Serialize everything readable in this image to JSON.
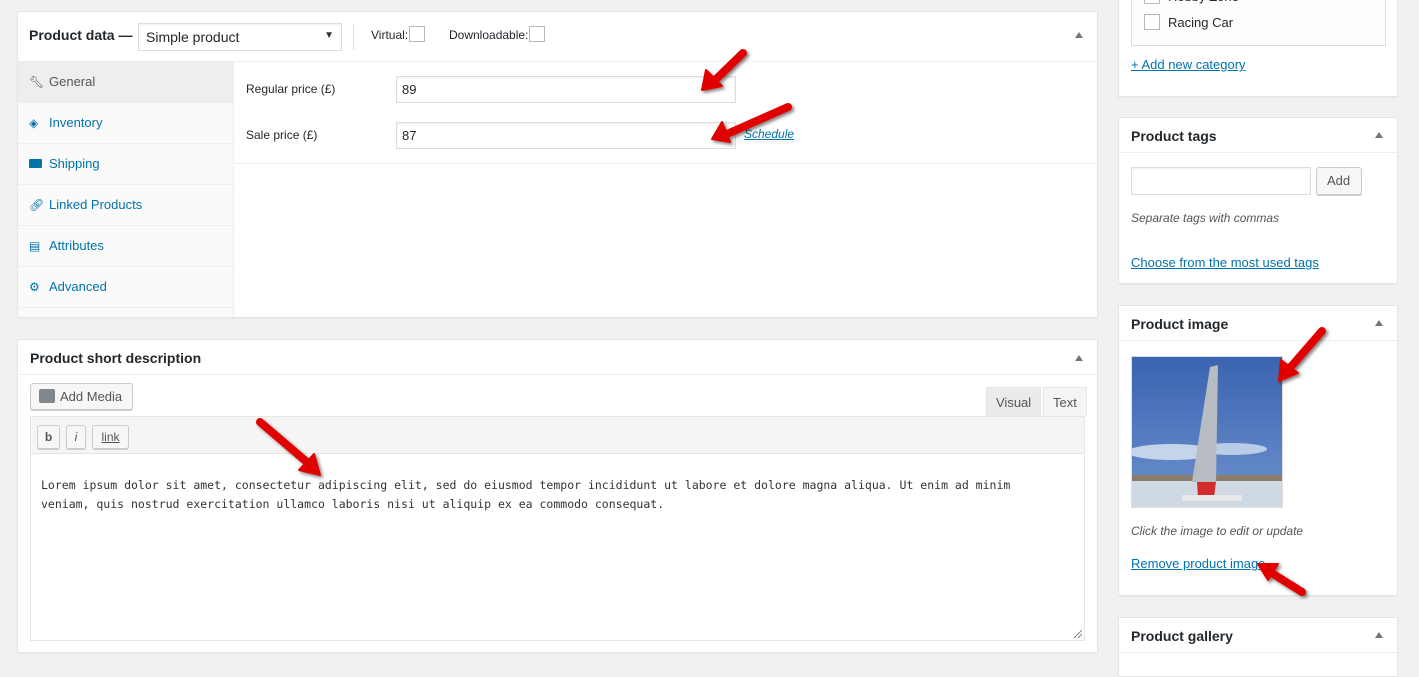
{
  "product_data": {
    "title": "Product data —",
    "product_type": "Simple product",
    "virtual_label": "Virtual:",
    "virtual_checked": false,
    "downloadable_label": "Downloadable:",
    "downloadable_checked": false,
    "tabs": [
      {
        "label": "General",
        "icon": "wrench-icon",
        "active": true
      },
      {
        "label": "Inventory",
        "icon": "tag-icon",
        "active": false
      },
      {
        "label": "Shipping",
        "icon": "truck-icon",
        "active": false
      },
      {
        "label": "Linked Products",
        "icon": "link-icon",
        "active": false
      },
      {
        "label": "Attributes",
        "icon": "list-icon",
        "active": false
      },
      {
        "label": "Advanced",
        "icon": "gear-icon",
        "active": false
      }
    ],
    "regular_price_label": "Regular price (£)",
    "regular_price": "89",
    "sale_price_label": "Sale price (£)",
    "sale_price": "87",
    "schedule_link": "Schedule"
  },
  "short_description": {
    "title": "Product short description",
    "add_media_label": "Add Media",
    "tab_visual": "Visual",
    "tab_text": "Text",
    "quicktags": [
      "b",
      "i",
      "link"
    ],
    "content_line1": "Lorem ipsum dolor sit amet, consectetur adipiscing elit, sed do eiusmod tempor incididunt ut labore et dolore magna aliqua. Ut enim ad minim",
    "content_line2": "veniam, quis nostrud exercitation ullamco laboris nisi ut aliquip ex ea commodo consequat."
  },
  "categories": {
    "items": [
      {
        "label": "Hobby Zone",
        "checked": true
      },
      {
        "label": "Racing Car",
        "checked": false
      }
    ],
    "add_new_link": "+ Add new category"
  },
  "tags": {
    "title": "Product tags",
    "input_value": "",
    "add_button": "Add",
    "hint": "Separate tags with commas",
    "choose_link": "Choose from the most used tags"
  },
  "product_image": {
    "title": "Product image",
    "image_alt": "Sailboat on beach",
    "hint": "Click the image to edit or update",
    "remove_link": "Remove product image"
  },
  "gallery": {
    "title": "Product gallery"
  },
  "colors": {
    "link": "#0073aa",
    "annotation_arrow": "#e00000"
  }
}
